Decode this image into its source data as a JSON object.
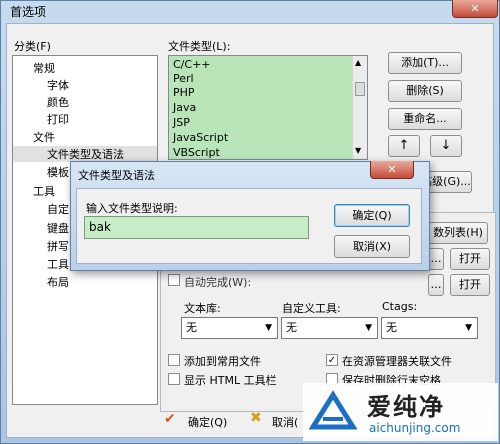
{
  "window": {
    "title": "首选项",
    "close_label": "✕"
  },
  "left": {
    "label": "分类(F)",
    "tree": [
      {
        "label": "常规"
      },
      {
        "label": "字体"
      },
      {
        "label": "颜色"
      },
      {
        "label": "打印"
      },
      {
        "label": "文件"
      },
      {
        "label": "文件类型及语法"
      },
      {
        "label": "模板"
      },
      {
        "label": "工具"
      },
      {
        "label": "自定"
      },
      {
        "label": "键盘"
      },
      {
        "label": "拼写"
      },
      {
        "label": "工具"
      },
      {
        "label": "布局"
      }
    ]
  },
  "filetypes": {
    "label": "文件类型(L):",
    "items": [
      "C/C++",
      "Perl",
      "PHP",
      "Java",
      "JSP",
      "JavaScript",
      "VBScript"
    ]
  },
  "buttons": {
    "add": "添加(T)...",
    "delete": "删除(S)",
    "rename": "重命名...",
    "up": "↑",
    "down": "↓",
    "advanced": "高级(G)...",
    "list": "数列表(H)",
    "open1": "打开",
    "open2": "打开",
    "ok": "确定(Q)",
    "cancel": "取消("
  },
  "lower": {
    "auto_complete_label": "自动完成(W):",
    "textlib_label": "文本库:",
    "custom_tool_label": "自定义工具:",
    "ctags_label": "Ctags:",
    "select_value": "无",
    "chk_common": "添加到常用文件",
    "chk_explorer": "在资源管理器关联文件",
    "chk_explorer_checked": true,
    "chk_html": "显示 HTML 工具栏",
    "chk_trailing": "保存时删除行末空格"
  },
  "dialog": {
    "title": "文件类型及语法",
    "prompt": "输入文件类型说明:",
    "value": "bak",
    "ok": "确定(Q)",
    "cancel": "取消(X)"
  },
  "watermark": {
    "brand": "爱纯净",
    "url": "aichunjing.com"
  }
}
